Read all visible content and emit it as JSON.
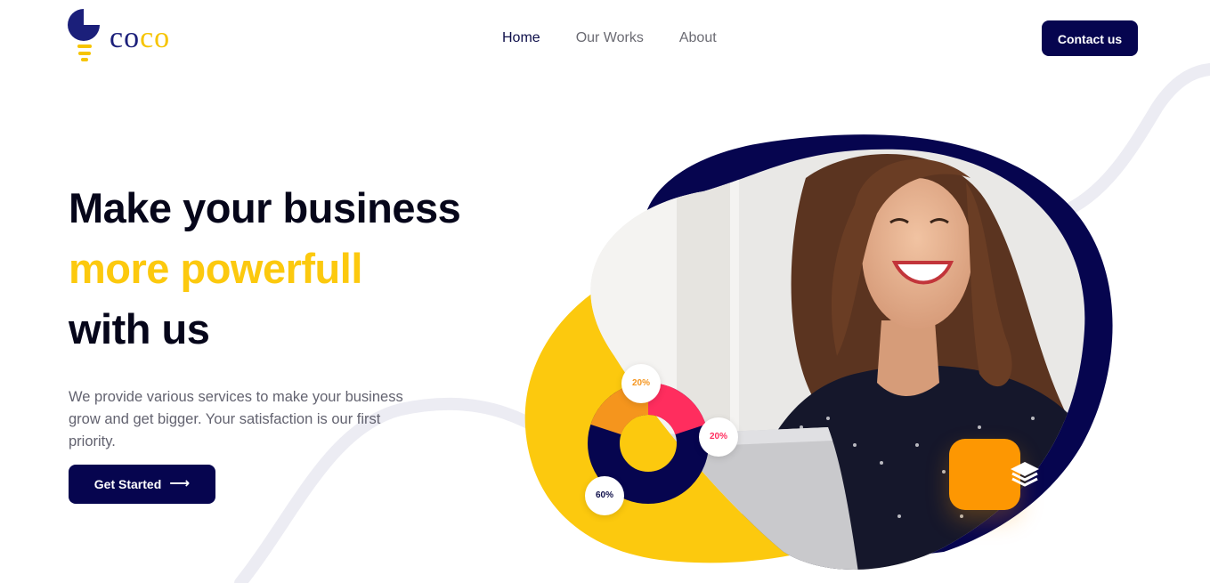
{
  "brand": {
    "name_part1": "co",
    "name_part2": "co",
    "logo_icon": "bulb-logo-icon"
  },
  "nav": {
    "items": [
      {
        "label": "Home",
        "active": true
      },
      {
        "label": "Our Works",
        "active": false
      },
      {
        "label": "About",
        "active": false
      }
    ],
    "contact_label": "Contact us"
  },
  "hero": {
    "line1": "Make your business",
    "line2": "more powerfull",
    "line3": "with us",
    "description": "We provide various services to make your business grow and get bigger. Your satisfaction is our first priority.",
    "cta_label": "Get Started",
    "cta_icon": "arrow-right-icon"
  },
  "stats": {
    "segment_orange": "20%",
    "segment_pink": "20%",
    "segment_navy": "60%"
  },
  "illustration": {
    "stack_icon": "layers-icon",
    "photo": "smiling-woman-with-laptop"
  },
  "colors": {
    "navy": "#06054f",
    "yellow": "#fcc90e",
    "orange": "#fd9702",
    "pink": "#ff2d5e"
  }
}
